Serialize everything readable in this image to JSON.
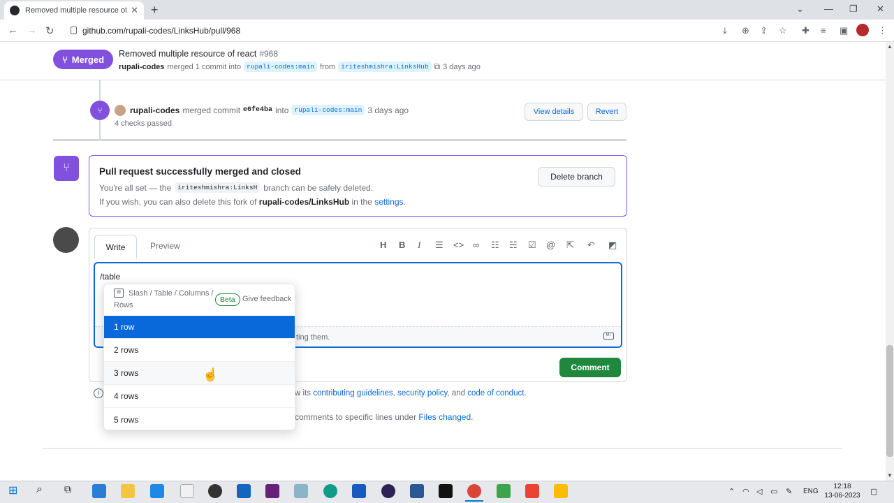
{
  "browser": {
    "tab_title": "Removed multiple resource of re",
    "url": "github.com/rupali-codes/LinksHub/pull/968",
    "new_tab": "+",
    "close_tab": "✕"
  },
  "header": {
    "status": "Merged",
    "title": "Removed multiple resource of react",
    "number": "#968",
    "author": "rupali-codes",
    "merged_text": "merged 1 commit into",
    "base_branch": "rupali-codes:main",
    "from_text": "from",
    "head_branch": "iriteshmishra:LinksHub",
    "time": "3 days ago"
  },
  "merge_event": {
    "author": "rupali-codes",
    "merged_commit": "merged commit",
    "sha": "e6fe4ba",
    "into": "into",
    "branch": "rupali-codes:main",
    "time": "3 days ago",
    "checks": "4 checks passed",
    "view_details": "View details",
    "revert": "Revert"
  },
  "merge_box": {
    "title": "Pull request successfully merged and closed",
    "line1_pre": "You're all set — the",
    "branch": "iriteshmishra:LinksH",
    "line1_post": "branch can be safely deleted.",
    "line2_pre": "If you wish, you can also delete this fork of",
    "fork": "rupali-codes/LinksHub",
    "line2_mid": "in the",
    "settings": "settings",
    "period": ".",
    "delete_branch": "Delete branch"
  },
  "comment": {
    "tab_write": "Write",
    "tab_preview": "Preview",
    "text": "/table",
    "attach_text": "ting them.",
    "submit": "Comment",
    "guidelines_pre": "w its",
    "contributing": "contributing guidelines",
    "comma": ",",
    "security": "security policy",
    "and": ", and",
    "conduct": "code of conduct",
    "period": ".",
    "tip_pre": "comments to specific lines under",
    "files_changed": "Files changed",
    "tip_post": "."
  },
  "toolbar_icons": [
    "heading-icon",
    "bold-icon",
    "italic-icon",
    "quote-icon",
    "code-icon",
    "link-icon",
    "unordered-list-icon",
    "ordered-list-icon",
    "task-list-icon",
    "mention-icon",
    "reference-icon",
    "reply-icon",
    "slash-command-icon"
  ],
  "dropdown": {
    "path": "Slash / Table / Columns /",
    "path2": "Rows",
    "beta": "Beta",
    "feedback": "Give feedback",
    "items": [
      "1 row",
      "2 rows",
      "3 rows",
      "4 rows",
      "5 rows"
    ],
    "selected": "1 row"
  },
  "taskbar": {
    "lang": "ENG",
    "time": "12:18",
    "date": "13-06-2023"
  },
  "colors": {
    "merged_purple": "#8250df",
    "link_blue": "#0969da",
    "comment_green": "#1f883d"
  }
}
